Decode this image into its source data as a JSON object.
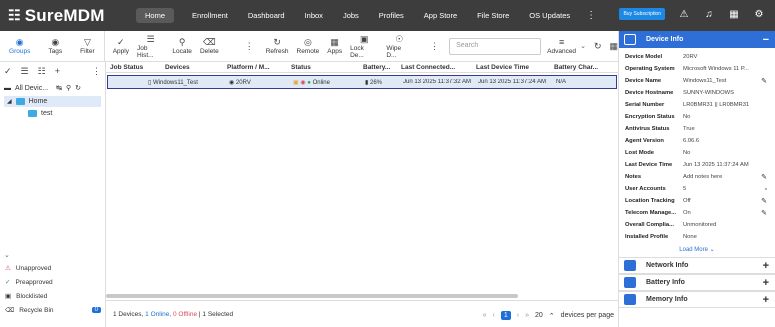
{
  "app": {
    "title": "SureMDM"
  },
  "nav": {
    "items": [
      "Home",
      "Enrollment",
      "Dashboard",
      "Inbox",
      "Jobs",
      "Profiles",
      "App Store",
      "File Store",
      "OS Updates"
    ]
  },
  "topbar": {
    "buy": "Buy Subscription"
  },
  "toolbar": {
    "groups_label": "Groups",
    "tags_label": "Tags",
    "filter_label": "Filter",
    "actions": [
      "Apply",
      "Job Hist...",
      "Locate",
      "Delete"
    ],
    "actions2": [
      "Refresh",
      "Remote",
      "Apps",
      "Lock De...",
      "Wipe D..."
    ],
    "search_placeholder": "Search",
    "advanced_label": "Advanced"
  },
  "sidebar": {
    "all_devices": "All Devic...",
    "home": "Home",
    "test": "test",
    "bottom": [
      "Unapproved",
      "Preapproved",
      "Blocklisted",
      "Recycle Bin"
    ],
    "recycle_count": "0"
  },
  "grid": {
    "columns": [
      "Job Status",
      "Devices",
      "Platform / M...",
      "Status",
      "Battery...",
      "Last Connected...",
      "Last Device Time",
      "Battery Char..."
    ],
    "rows": [
      {
        "device": "Windows11_Test",
        "platform": "20RV",
        "status": "Online",
        "battery": "26%",
        "last_connected": "Jun 13 2025 11:37:32 AM",
        "last_device_time": "Jun 13 2025 11:37:24 AM",
        "battery_charge": "N/A"
      }
    ],
    "footer": {
      "total": "1 Devices,",
      "online": "1 Online,",
      "offline": "0 Offline",
      "selected": "1 Selected"
    },
    "pager": {
      "page": "1",
      "per_page": "20",
      "per_page_label": "devices per page"
    }
  },
  "panel": {
    "title": "Device Info",
    "rows": [
      {
        "k": "Device Model",
        "v": "20RV"
      },
      {
        "k": "Operating System",
        "v": "Microsoft Windows 11 P..."
      },
      {
        "k": "Device Name",
        "v": "Windows11_Test"
      },
      {
        "k": "Device Hostname",
        "v": "SUNNY-WINDOWS"
      },
      {
        "k": "Serial Number",
        "v": "LR0BMR31 || LR0BMR31"
      },
      {
        "k": "Encryption Status",
        "v": "No"
      },
      {
        "k": "Antivirus Status",
        "v": "True"
      },
      {
        "k": "Agent Version",
        "v": "6.06.6"
      },
      {
        "k": "Lost Mode",
        "v": "No"
      },
      {
        "k": "Last Device Time",
        "v": "Jun 13 2025 11:37:24 AM"
      },
      {
        "k": "Notes",
        "v": "Add notes here"
      },
      {
        "k": "User Accounts",
        "v": "5"
      },
      {
        "k": "Location Tracking",
        "v": "Off"
      },
      {
        "k": "Telecom Manage...",
        "v": "On"
      },
      {
        "k": "Overall Complia...",
        "v": "Unmonitored"
      },
      {
        "k": "Installed Profile",
        "v": "None"
      }
    ],
    "load_more": "Load More",
    "sections": [
      "Network Info",
      "Battery Info",
      "Memory Info"
    ]
  }
}
